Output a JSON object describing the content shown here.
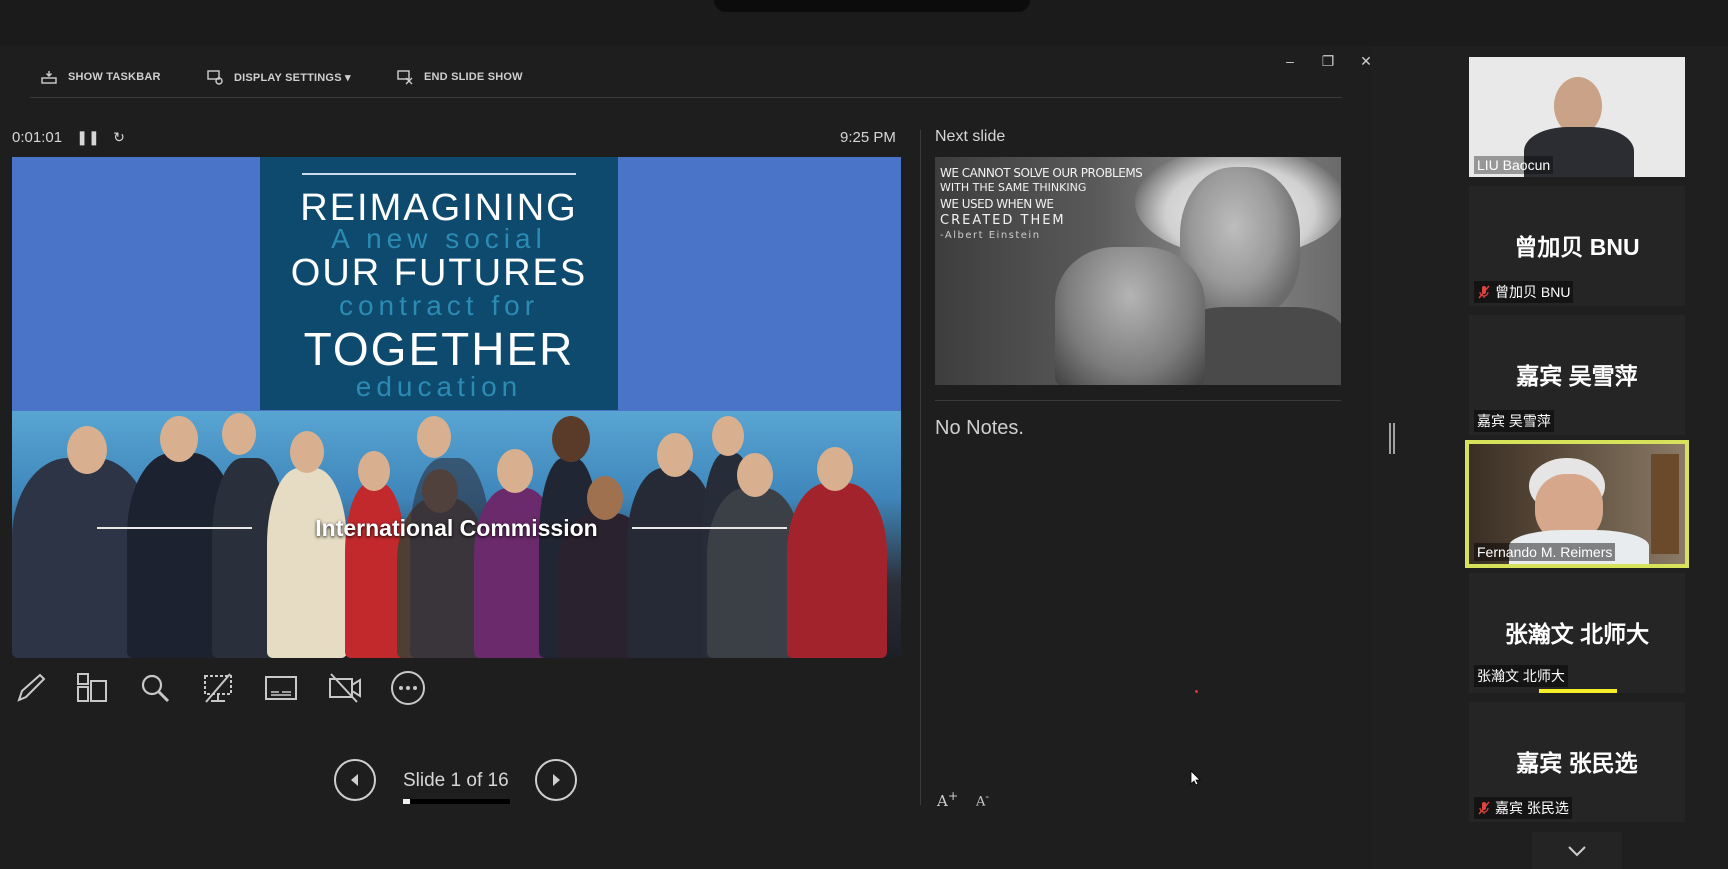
{
  "toolbar": {
    "show_taskbar": "SHOW TASKBAR",
    "display_settings": "DISPLAY SETTINGS ▾",
    "end_slide_show": "END SLIDE SHOW"
  },
  "window_controls": {
    "minimize": "–",
    "restore": "❐",
    "close": "✕"
  },
  "presenter": {
    "elapsed_time": "0:01:01",
    "clock": "9:25 PM",
    "next_slide_label": "Next slide",
    "notes": "No Notes.",
    "slide_counter": "Slide 1 of 16",
    "progress_fraction": 0.0625
  },
  "current_slide": {
    "line_1": "REIMAGINING",
    "line_2": "A new social",
    "line_3": "OUR FUTURES",
    "line_4": "contract for",
    "line_5": "TOGETHER",
    "line_6": "education",
    "caption": "International Commission"
  },
  "next_slide": {
    "quote_line_1": "WE CANNOT SOLVE OUR PROBLEMS",
    "quote_line_2": "WITH THE SAME THINKING",
    "quote_line_3": "WE USED WHEN WE",
    "quote_line_4": "CREATED THEM",
    "quote_author": "-Albert Einstein"
  },
  "font_buttons": {
    "increase": "A",
    "decrease": "A"
  },
  "participants": [
    {
      "name": "LIU Baocun",
      "video": true,
      "muted": false
    },
    {
      "name": "曾加贝 BNU",
      "display": "曾加贝 BNU",
      "video": false,
      "muted": true
    },
    {
      "name": "嘉宾 吴雪萍",
      "display": "嘉宾 吴雪萍",
      "video": false,
      "muted": false
    },
    {
      "name": "Fernando M. Reimers",
      "video": true,
      "muted": false,
      "active_speaker": true
    },
    {
      "name": "张瀚文 北师大",
      "display": "张瀚文 北师大",
      "video": false,
      "muted": false,
      "speaking": true
    },
    {
      "name": "嘉宾 张民选",
      "display": "嘉宾 张民选",
      "video": false,
      "muted": true
    }
  ],
  "colors": {
    "background": "#1f1f1f",
    "slide_blue": "#4a74c8",
    "banner_teal": "#0d4a6d",
    "active_speaker_border": "#d6e25a",
    "mute_red": "#e0443e"
  },
  "icons": [
    "taskbar-icon",
    "display-settings-icon",
    "end-show-icon",
    "pause-icon",
    "restart-icon",
    "pen-icon",
    "see-all-slides-icon",
    "zoom-icon",
    "black-screen-icon",
    "subtitles-icon",
    "camera-off-icon",
    "more-options-icon",
    "previous-icon",
    "next-icon",
    "mute-icon",
    "chevron-down-icon"
  ]
}
